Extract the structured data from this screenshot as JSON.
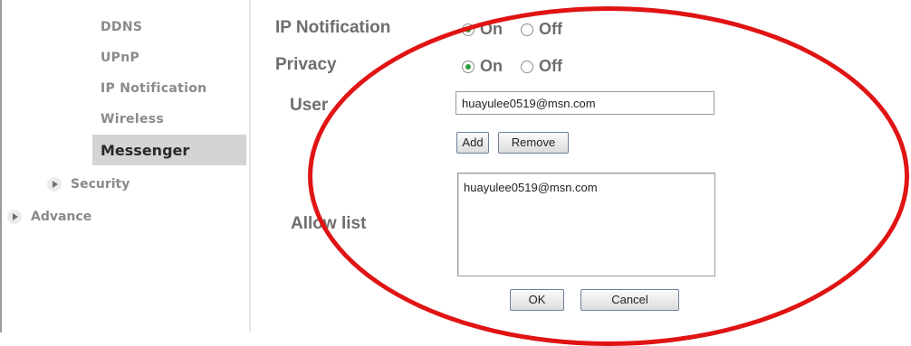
{
  "sidebar": {
    "items": [
      {
        "label": "DDNS"
      },
      {
        "label": "UPnP"
      },
      {
        "label": "IP Notification"
      },
      {
        "label": "Wireless"
      },
      {
        "label": "Messenger"
      }
    ],
    "groups": [
      {
        "label": "Security",
        "icon": "expand-arrow-icon"
      },
      {
        "label": "Advance",
        "icon": "expand-arrow-icon"
      }
    ]
  },
  "form": {
    "ip_notification": {
      "label": "IP Notification",
      "on": "On",
      "off": "Off",
      "selected": "On"
    },
    "privacy": {
      "label": "Privacy",
      "on": "On",
      "off": "Off",
      "selected": "On"
    },
    "user": {
      "label": "User",
      "value": "huayulee0519@msn.com"
    },
    "add_label": "Add",
    "remove_label": "Remove",
    "allow_list": {
      "label": "Allow list",
      "entries": [
        "huayulee0519@msn.com"
      ]
    },
    "ok_label": "OK",
    "cancel_label": "Cancel"
  },
  "annotation": {
    "color": "#e01414"
  }
}
